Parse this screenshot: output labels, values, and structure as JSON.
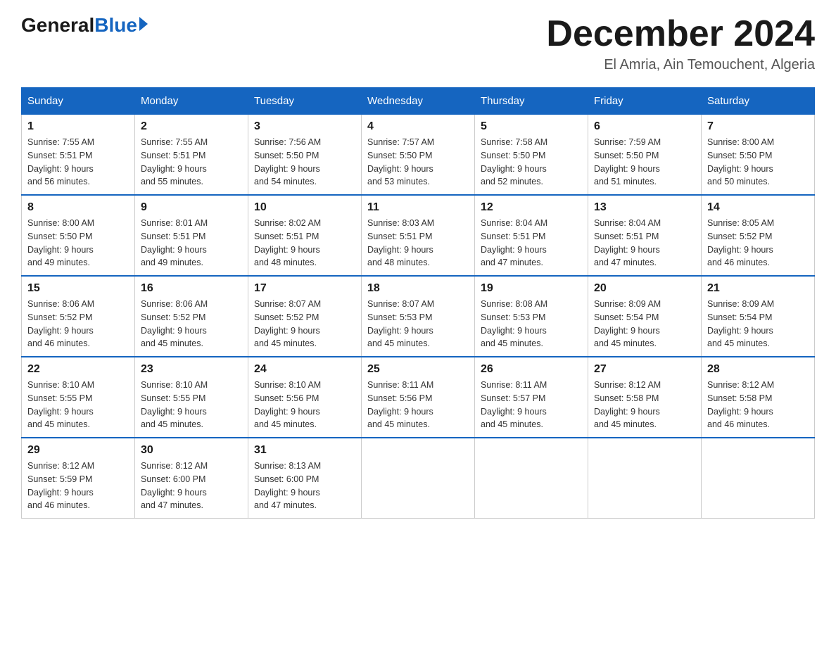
{
  "logo": {
    "general": "General",
    "blue": "Blue"
  },
  "title": "December 2024",
  "location": "El Amria, Ain Temouchent, Algeria",
  "days_of_week": [
    "Sunday",
    "Monday",
    "Tuesday",
    "Wednesday",
    "Thursday",
    "Friday",
    "Saturday"
  ],
  "weeks": [
    [
      {
        "day": "1",
        "sunrise": "7:55 AM",
        "sunset": "5:51 PM",
        "daylight": "9 hours and 56 minutes."
      },
      {
        "day": "2",
        "sunrise": "7:55 AM",
        "sunset": "5:51 PM",
        "daylight": "9 hours and 55 minutes."
      },
      {
        "day": "3",
        "sunrise": "7:56 AM",
        "sunset": "5:50 PM",
        "daylight": "9 hours and 54 minutes."
      },
      {
        "day": "4",
        "sunrise": "7:57 AM",
        "sunset": "5:50 PM",
        "daylight": "9 hours and 53 minutes."
      },
      {
        "day": "5",
        "sunrise": "7:58 AM",
        "sunset": "5:50 PM",
        "daylight": "9 hours and 52 minutes."
      },
      {
        "day": "6",
        "sunrise": "7:59 AM",
        "sunset": "5:50 PM",
        "daylight": "9 hours and 51 minutes."
      },
      {
        "day": "7",
        "sunrise": "8:00 AM",
        "sunset": "5:50 PM",
        "daylight": "9 hours and 50 minutes."
      }
    ],
    [
      {
        "day": "8",
        "sunrise": "8:00 AM",
        "sunset": "5:50 PM",
        "daylight": "9 hours and 49 minutes."
      },
      {
        "day": "9",
        "sunrise": "8:01 AM",
        "sunset": "5:51 PM",
        "daylight": "9 hours and 49 minutes."
      },
      {
        "day": "10",
        "sunrise": "8:02 AM",
        "sunset": "5:51 PM",
        "daylight": "9 hours and 48 minutes."
      },
      {
        "day": "11",
        "sunrise": "8:03 AM",
        "sunset": "5:51 PM",
        "daylight": "9 hours and 48 minutes."
      },
      {
        "day": "12",
        "sunrise": "8:04 AM",
        "sunset": "5:51 PM",
        "daylight": "9 hours and 47 minutes."
      },
      {
        "day": "13",
        "sunrise": "8:04 AM",
        "sunset": "5:51 PM",
        "daylight": "9 hours and 47 minutes."
      },
      {
        "day": "14",
        "sunrise": "8:05 AM",
        "sunset": "5:52 PM",
        "daylight": "9 hours and 46 minutes."
      }
    ],
    [
      {
        "day": "15",
        "sunrise": "8:06 AM",
        "sunset": "5:52 PM",
        "daylight": "9 hours and 46 minutes."
      },
      {
        "day": "16",
        "sunrise": "8:06 AM",
        "sunset": "5:52 PM",
        "daylight": "9 hours and 45 minutes."
      },
      {
        "day": "17",
        "sunrise": "8:07 AM",
        "sunset": "5:52 PM",
        "daylight": "9 hours and 45 minutes."
      },
      {
        "day": "18",
        "sunrise": "8:07 AM",
        "sunset": "5:53 PM",
        "daylight": "9 hours and 45 minutes."
      },
      {
        "day": "19",
        "sunrise": "8:08 AM",
        "sunset": "5:53 PM",
        "daylight": "9 hours and 45 minutes."
      },
      {
        "day": "20",
        "sunrise": "8:09 AM",
        "sunset": "5:54 PM",
        "daylight": "9 hours and 45 minutes."
      },
      {
        "day": "21",
        "sunrise": "8:09 AM",
        "sunset": "5:54 PM",
        "daylight": "9 hours and 45 minutes."
      }
    ],
    [
      {
        "day": "22",
        "sunrise": "8:10 AM",
        "sunset": "5:55 PM",
        "daylight": "9 hours and 45 minutes."
      },
      {
        "day": "23",
        "sunrise": "8:10 AM",
        "sunset": "5:55 PM",
        "daylight": "9 hours and 45 minutes."
      },
      {
        "day": "24",
        "sunrise": "8:10 AM",
        "sunset": "5:56 PM",
        "daylight": "9 hours and 45 minutes."
      },
      {
        "day": "25",
        "sunrise": "8:11 AM",
        "sunset": "5:56 PM",
        "daylight": "9 hours and 45 minutes."
      },
      {
        "day": "26",
        "sunrise": "8:11 AM",
        "sunset": "5:57 PM",
        "daylight": "9 hours and 45 minutes."
      },
      {
        "day": "27",
        "sunrise": "8:12 AM",
        "sunset": "5:58 PM",
        "daylight": "9 hours and 45 minutes."
      },
      {
        "day": "28",
        "sunrise": "8:12 AM",
        "sunset": "5:58 PM",
        "daylight": "9 hours and 46 minutes."
      }
    ],
    [
      {
        "day": "29",
        "sunrise": "8:12 AM",
        "sunset": "5:59 PM",
        "daylight": "9 hours and 46 minutes."
      },
      {
        "day": "30",
        "sunrise": "8:12 AM",
        "sunset": "6:00 PM",
        "daylight": "9 hours and 47 minutes."
      },
      {
        "day": "31",
        "sunrise": "8:13 AM",
        "sunset": "6:00 PM",
        "daylight": "9 hours and 47 minutes."
      },
      null,
      null,
      null,
      null
    ]
  ]
}
